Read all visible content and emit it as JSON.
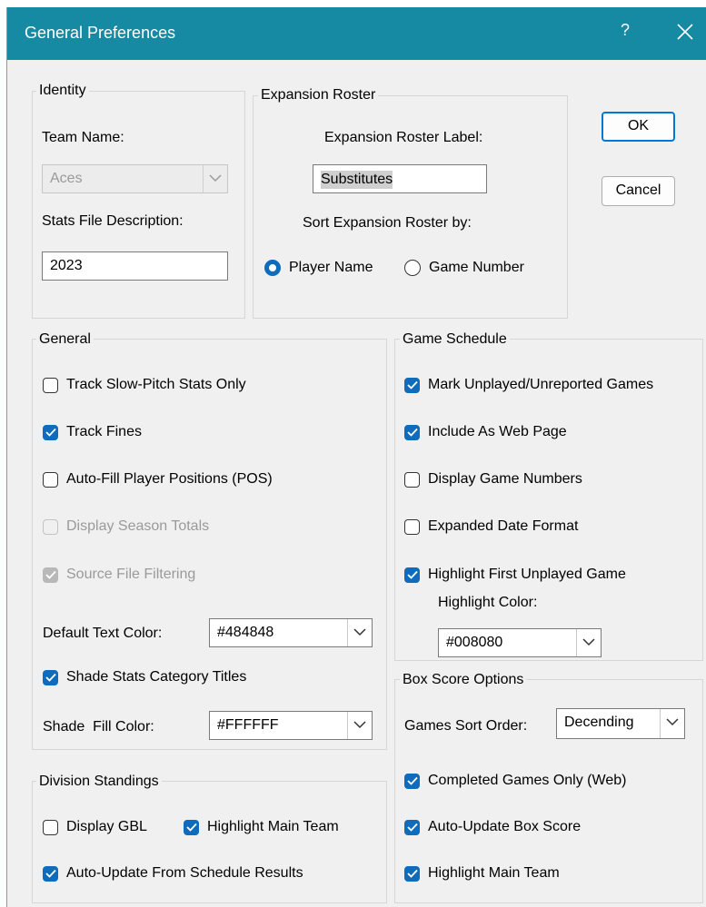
{
  "window": {
    "title": "General Preferences",
    "help_glyph": "?"
  },
  "buttons": {
    "ok": "OK",
    "cancel": "Cancel"
  },
  "identity": {
    "legend": "Identity",
    "team_name_label": "Team Name:",
    "team_name_value": "Aces",
    "stats_file_label": "Stats File Description:",
    "stats_file_value": "2023"
  },
  "expansion": {
    "legend": "Expansion Roster",
    "label_caption": "Expansion Roster Label:",
    "label_value": "Substitutes",
    "sort_caption": "Sort Expansion Roster by:",
    "options": [
      {
        "label": "Player Name",
        "selected": true
      },
      {
        "label": "Game Number",
        "selected": false
      }
    ]
  },
  "general": {
    "legend": "General",
    "checkboxes": [
      {
        "label": "Track Slow-Pitch Stats Only",
        "checked": false,
        "enabled": true
      },
      {
        "label": "Track Fines",
        "checked": true,
        "enabled": true
      },
      {
        "label": "Auto-Fill Player Positions (POS)",
        "checked": false,
        "enabled": true
      },
      {
        "label": "Display Season Totals",
        "checked": false,
        "enabled": false
      },
      {
        "label": "Source File Filtering",
        "checked": true,
        "enabled": false
      }
    ],
    "text_color_label": "Default Text Color:",
    "text_color_value": "#484848",
    "shade_titles_label": "Shade Stats Category Titles",
    "shade_titles_checked": true,
    "fill_color_label": "Shade  Fill Color:",
    "fill_color_value": "#FFFFFF"
  },
  "division": {
    "legend": "Division Standings",
    "display_gbl": {
      "label": "Display GBL",
      "checked": false
    },
    "highlight_main": {
      "label": "Highlight Main Team",
      "checked": true
    },
    "auto_update": {
      "label": "Auto-Update From Schedule Results",
      "checked": true
    }
  },
  "schedule": {
    "legend": "Game Schedule",
    "checkboxes": [
      {
        "label": "Mark Unplayed/Unreported Games",
        "checked": true
      },
      {
        "label": "Include As Web Page",
        "checked": true
      },
      {
        "label": "Display Game Numbers",
        "checked": false
      },
      {
        "label": "Expanded Date Format",
        "checked": false
      },
      {
        "label": "Highlight First Unplayed Game",
        "checked": true
      }
    ],
    "highlight_color_label": "Highlight Color:",
    "highlight_color_value": "#008080"
  },
  "boxscore": {
    "legend": "Box Score Options",
    "sort_label": "Games Sort Order:",
    "sort_value": "Decending",
    "checkboxes": [
      {
        "label": "Completed Games Only (Web)",
        "checked": true
      },
      {
        "label": "Auto-Update Box Score",
        "checked": true
      },
      {
        "label": "Highlight Main Team",
        "checked": true
      }
    ]
  },
  "colors": {
    "titlebar": "#1689a3",
    "accent": "#0f6cbd",
    "background": "#f0f0f0"
  }
}
